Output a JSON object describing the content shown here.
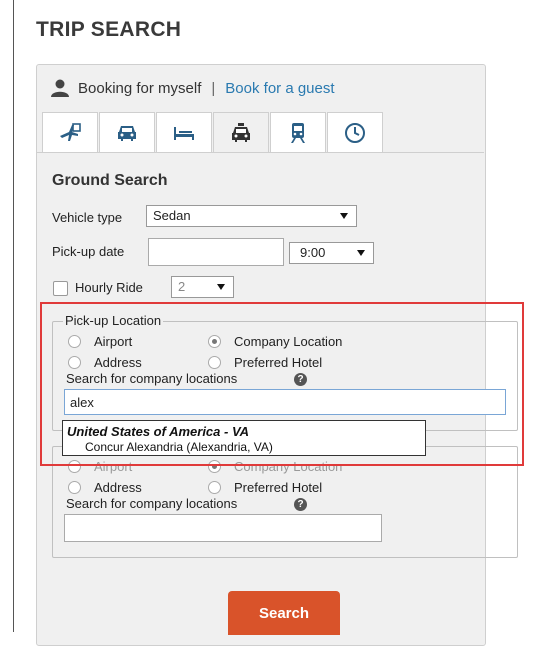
{
  "page": {
    "title": "TRIP SEARCH"
  },
  "booking": {
    "self_label": "Booking for myself",
    "separator": "|",
    "guest_link": "Book for a guest"
  },
  "tabs": [
    {
      "icon": "flight-hotel-icon"
    },
    {
      "icon": "car-icon"
    },
    {
      "icon": "hotel-icon"
    },
    {
      "icon": "taxi-icon"
    },
    {
      "icon": "train-icon"
    },
    {
      "icon": "clock-icon"
    }
  ],
  "ground": {
    "title": "Ground Search",
    "vehicle_label": "Vehicle type",
    "vehicle_value": "Sedan",
    "pickup_date_label": "Pick-up date",
    "pickup_date_value": "",
    "pickup_time_value": "9:00",
    "hourly_label": "Hourly Ride",
    "hourly_value": "2"
  },
  "pickup": {
    "legend": "Pick-up Location",
    "opt_airport": "Airport",
    "opt_company": "Company Location",
    "opt_address": "Address",
    "opt_hotel": "Preferred Hotel",
    "search_label": "Search for company locations",
    "search_value": "alex"
  },
  "autocomplete": {
    "group": "United States of America - VA",
    "item": "Concur Alexandria (Alexandria, VA)"
  },
  "dropoff": {
    "opt_airport": "Airport",
    "opt_company": "Company Location",
    "opt_address": "Address",
    "opt_hotel": "Preferred Hotel",
    "search_label": "Search for company locations",
    "search_value": ""
  },
  "actions": {
    "search_label": "Search"
  },
  "colors": {
    "accent": "#d9532a",
    "link": "#2a7ab0",
    "highlight": "#e03a3a"
  }
}
